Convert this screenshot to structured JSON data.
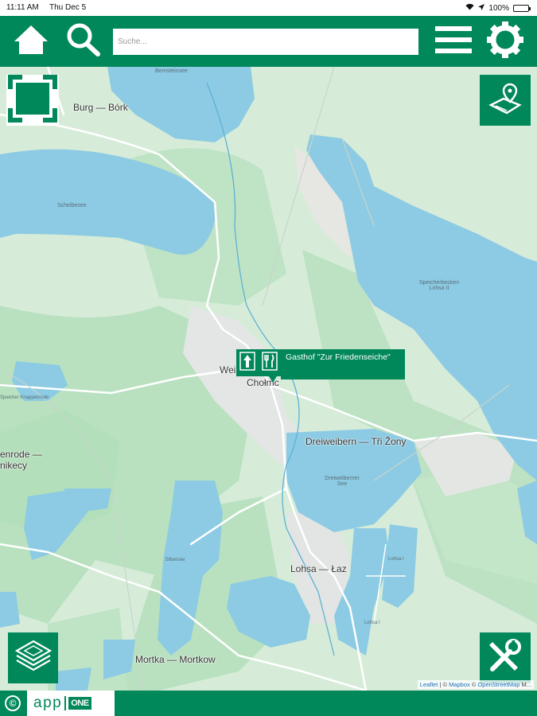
{
  "status_bar": {
    "time": "11:11 AM",
    "date": "Thu Dec 5",
    "battery": "100%"
  },
  "header": {
    "search_placeholder": "Suche...",
    "icons": [
      "home-icon",
      "search-icon",
      "menu-icon",
      "gear-icon"
    ]
  },
  "map": {
    "places": {
      "burg": "Burg — Bórk",
      "weisskollm_a": "Weißkollm",
      "weisskollm_b": "Chołmc",
      "dreiweibern": "Dreiweibern — Tři Žony",
      "enrode_a": "enrode —",
      "enrode_b": "nikecy",
      "lohsa": "Lohsa — Łaz",
      "mortka": "Mortka — Mortkow"
    },
    "water_labels": {
      "bergsee": "Bernsteinsee",
      "scheibesee": "Scheibesee",
      "speicherbecken_lohsa": "Speicherbecken Lohsa II",
      "dreiweiberner_see": "Dreiweiberner See",
      "knappenrode": "Speicher Knappenrode",
      "silbersee": "Silbersee",
      "lohsa_i_a": "Lohsa I",
      "lohsa_i_b": "Lohsa I"
    },
    "attribution": {
      "leaflet": "Leaflet",
      "sep": " | © ",
      "mapbox": "Mapbox",
      "sep2": " © ",
      "osm": "OpenStreetMap",
      "tail": " M..."
    }
  },
  "poi": {
    "icons": [
      "parking-arrow-icon",
      "restaurant-icon"
    ],
    "popup_text": "Gasthof \"Zur Friedenseiche\""
  },
  "controls": {
    "top_left": "fullscreen-icon",
    "top_right": "map-location-icon",
    "bottom_left": "layers-icon",
    "bottom_right": "tools-icon"
  },
  "footer": {
    "copyright": "©",
    "logo_app": "app",
    "logo_one": "ONE"
  },
  "colors": {
    "brand": "#00875a",
    "water": "#8ccbe3",
    "forest": "#b8e0bf",
    "land": "#d5ecd8"
  }
}
